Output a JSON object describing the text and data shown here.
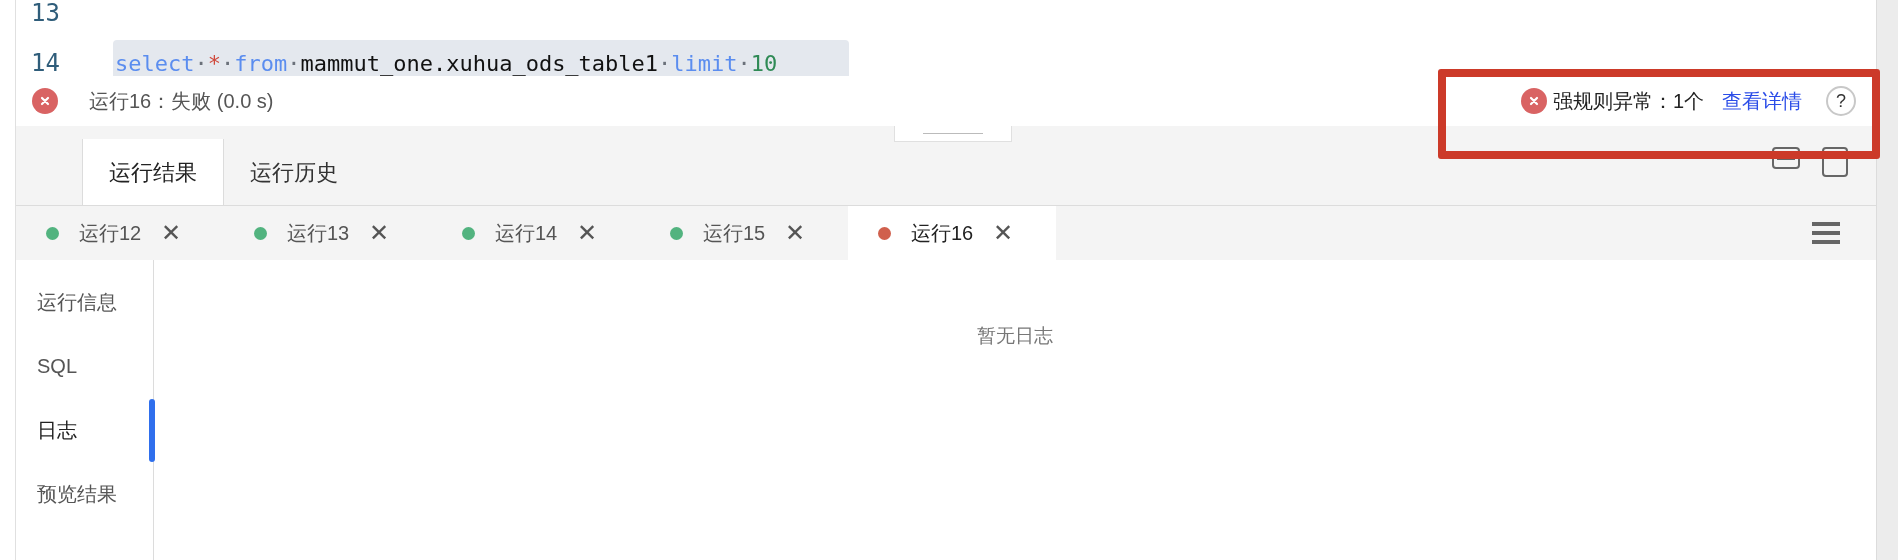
{
  "editor": {
    "lines": [
      {
        "number": "13"
      },
      {
        "number": "14",
        "highlighted": true,
        "tokens": [
          {
            "kind": "keyword",
            "text": "select"
          },
          {
            "kind": "space",
            "text": "·"
          },
          {
            "kind": "operator",
            "text": "*"
          },
          {
            "kind": "space",
            "text": "·"
          },
          {
            "kind": "keyword",
            "text": "from"
          },
          {
            "kind": "space",
            "text": "·"
          },
          {
            "kind": "identifier",
            "text": "mammut_one.xuhua_ods_table1"
          },
          {
            "kind": "space",
            "text": "·"
          },
          {
            "kind": "keyword",
            "text": "limit"
          },
          {
            "kind": "space",
            "text": "·"
          },
          {
            "kind": "number",
            "text": "10"
          }
        ]
      }
    ]
  },
  "status": {
    "message": "运行16：失败 (0.0 s)",
    "rule_alert": {
      "text": "强规则异常：1个",
      "link": "查看详情",
      "help": "?"
    }
  },
  "result_tabs": [
    {
      "label": "运行结果",
      "selected": true
    },
    {
      "label": "运行历史",
      "selected": false
    }
  ],
  "runs": [
    {
      "label": "运行12",
      "close": "✕",
      "color": "#52b37f",
      "selected": false
    },
    {
      "label": "运行13",
      "close": "✕",
      "color": "#52b37f",
      "selected": false
    },
    {
      "label": "运行14",
      "close": "✕",
      "color": "#52b37f",
      "selected": false
    },
    {
      "label": "运行15",
      "close": "✕",
      "color": "#52b37f",
      "selected": false
    },
    {
      "label": "运行16",
      "close": "✕",
      "color": "#d0604d",
      "selected": true
    }
  ],
  "side_nav": [
    {
      "label": "运行信息",
      "selected": false
    },
    {
      "label": "SQL",
      "selected": false
    },
    {
      "label": "日志",
      "selected": true
    },
    {
      "label": "预览结果",
      "selected": false
    }
  ],
  "empty_text": "暂无日志"
}
